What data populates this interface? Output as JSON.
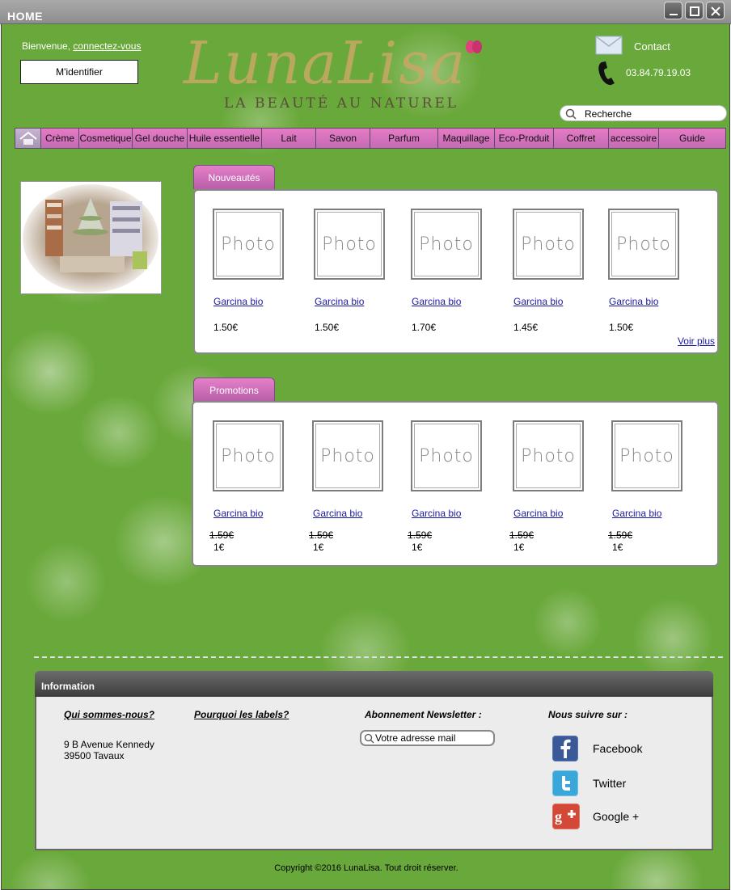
{
  "window": {
    "title": "HOME"
  },
  "header": {
    "welcome": "Bienvenue,",
    "login_link": "connectez-vous",
    "login_button": "M'identifier",
    "brand": "LunaLisa",
    "tagline": "LA BEAUTÉ AU NATUREL",
    "contact_label": "Contact",
    "phone": "03.84.79.19.03",
    "search_placeholder": "Recherche"
  },
  "nav": {
    "items": [
      "Crème",
      "Cosmetique",
      "Gel douche",
      "Huile essentielle",
      "Lait",
      "Savon",
      "Parfum",
      "Maquillage",
      "Eco-Produit",
      "Coffret",
      "accessoire",
      "Guide"
    ]
  },
  "nouveautes": {
    "tab": "Nouveautés",
    "products": [
      {
        "photo": "Photo",
        "name": "Garcina bio",
        "price": "1.50€"
      },
      {
        "photo": "Photo",
        "name": "Garcina bio",
        "price": "1.50€"
      },
      {
        "photo": "Photo",
        "name": "Garcina bio",
        "price": "1.70€"
      },
      {
        "photo": "Photo",
        "name": "Garcina bio",
        "price": "1.45€"
      },
      {
        "photo": "Photo",
        "name": "Garcina bio",
        "price": "1.50€"
      }
    ],
    "more": "Voir plus"
  },
  "promotions": {
    "tab": "Promotions",
    "products": [
      {
        "photo": "Photo",
        "name": "Garcina bio",
        "old_price": "1.59€",
        "new_price": "1€"
      },
      {
        "photo": "Photo",
        "name": "Garcina bio",
        "old_price": "1.59€",
        "new_price": "1€"
      },
      {
        "photo": "Photo",
        "name": "Garcina bio",
        "old_price": "1.59€",
        "new_price": "1€"
      },
      {
        "photo": "Photo",
        "name": "Garcina bio",
        "old_price": "1.59€",
        "new_price": "1€"
      },
      {
        "photo": "Photo",
        "name": "Garcina bio",
        "old_price": "1.59€",
        "new_price": "1€"
      }
    ]
  },
  "info": {
    "header": "Information",
    "about": "Qui sommes-nous?",
    "labels": "Pourquoi les labels?",
    "address_line1": "9 B Avenue Kennedy",
    "address_line2": "39500 Tavaux",
    "newsletter_title": "Abonnement Newsletter :",
    "newsletter_placeholder": "Votre adresse mail",
    "follow_title": "Nous suivre sur :",
    "social": [
      {
        "label": "Facebook",
        "icon": "facebook-icon",
        "color": "#3b5998"
      },
      {
        "label": "Twitter",
        "icon": "twitter-icon",
        "color": "#3aa7da"
      },
      {
        "label": "Google +",
        "icon": "google-plus-icon",
        "color": "#d34836"
      }
    ]
  },
  "footer": {
    "copyright": "Copyright ©2016 LunaLisa. Tout droit réserver."
  },
  "colors": {
    "background": "#69a83a",
    "nav": "#d86fbd",
    "tab": "#d274c0",
    "link": "#1a1aa6"
  }
}
